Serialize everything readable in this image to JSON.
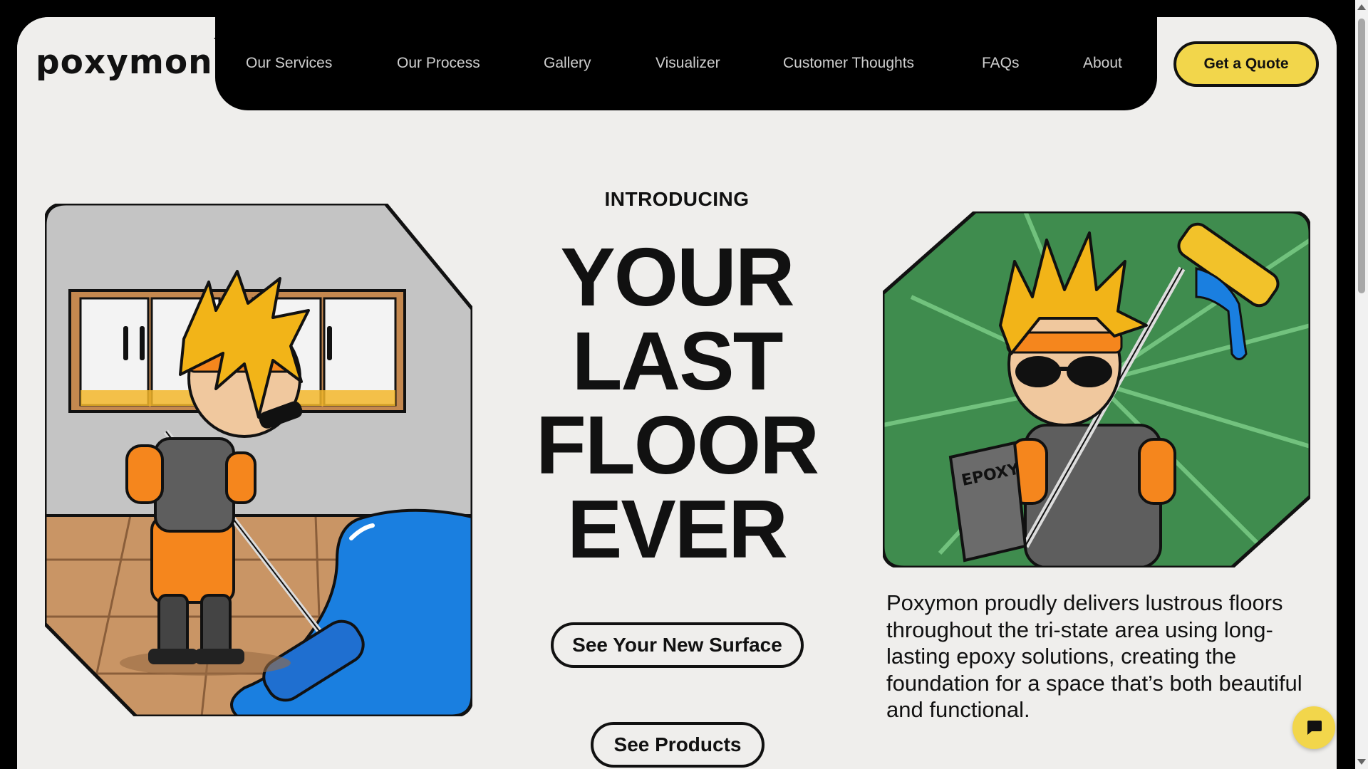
{
  "brand": {
    "logo_text": "poxymon",
    "trademark": "TM"
  },
  "nav": {
    "items": [
      {
        "label": "Our Services"
      },
      {
        "label": "Our Process"
      },
      {
        "label": "Gallery"
      },
      {
        "label": "Visualizer"
      },
      {
        "label": "Customer Thoughts"
      },
      {
        "label": "FAQs"
      },
      {
        "label": "About"
      }
    ],
    "cta_label": "Get a Quote"
  },
  "hero": {
    "eyebrow": "INTRODUCING",
    "headline_lines": [
      "YOUR",
      "LAST",
      "FLOOR",
      "EVER"
    ],
    "primary_button": "See Your New Surface",
    "secondary_button": "See Products",
    "description": "Poxymon proudly delivers lustrous floors throughout the tri-state area using long-lasting epoxy solutions, creating the foundation for a space that’s both beautiful and functional.",
    "bucket_label": "EPOXY"
  },
  "colors": {
    "accent_yellow": "#f2d64b",
    "page_bg": "#efeeec",
    "nav_bg": "#000000",
    "epoxy_blue": "#1a7fe0",
    "card_green": "#3f8c4e"
  },
  "widgets": {
    "chat_icon": "chat-bubble-icon"
  }
}
